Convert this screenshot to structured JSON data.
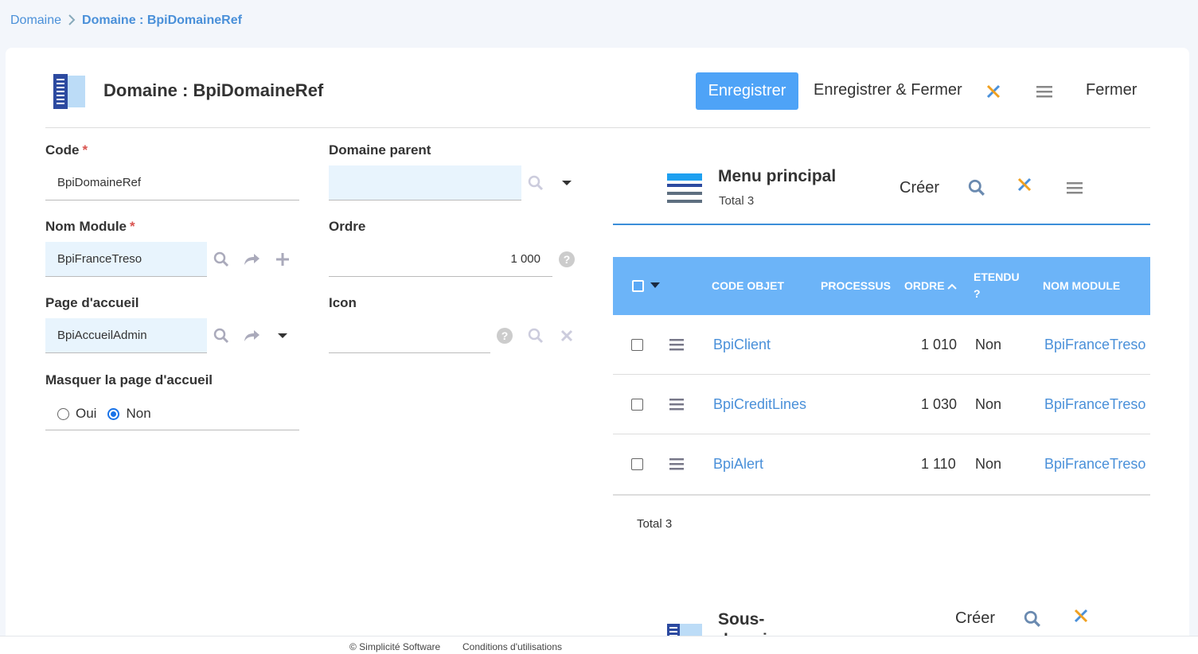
{
  "breadcrumb": {
    "parent": "Domaine",
    "current": "Domaine : BpiDomaineRef"
  },
  "header": {
    "title": "Domaine : BpiDomaineRef",
    "save_label": "Enregistrer",
    "save_close_label": "Enregistrer & Fermer",
    "close_label": "Fermer"
  },
  "form": {
    "code": {
      "label": "Code",
      "required": "*",
      "value": "BpiDomaineRef"
    },
    "nom_module": {
      "label": "Nom Module",
      "required": "*",
      "value": "BpiFranceTreso"
    },
    "page_accueil": {
      "label": "Page d'accueil",
      "value": "BpiAccueilAdmin"
    },
    "masquer": {
      "label": "Masquer la page d'accueil",
      "oui": "Oui",
      "non": "Non",
      "selected": "Non"
    },
    "domaine_parent": {
      "label": "Domaine parent",
      "value": ""
    },
    "ordre": {
      "label": "Ordre",
      "value": "1 000"
    },
    "icon": {
      "label": "Icon",
      "value": ""
    }
  },
  "menu": {
    "title": "Menu principal",
    "total": "Total 3",
    "create_label": "Créer",
    "columns": [
      "CODE OBJET",
      "PROCESSUS",
      "ORDRE",
      "ETENDU ?",
      "NOM MODULE"
    ],
    "rows": [
      {
        "code": "BpiClient",
        "processus": "",
        "ordre": "1 010",
        "etendu": "Non",
        "module": "BpiFranceTreso"
      },
      {
        "code": "BpiCreditLines",
        "processus": "",
        "ordre": "1 030",
        "etendu": "Non",
        "module": "BpiFranceTreso"
      },
      {
        "code": "BpiAlert",
        "processus": "",
        "ordre": "1 110",
        "etendu": "Non",
        "module": "BpiFranceTreso"
      }
    ],
    "footer_total": "Total 3"
  },
  "subdomain": {
    "title": "Sous-domaines",
    "create_label": "Créer"
  },
  "footer": {
    "copyright": "© Simplicité Software",
    "terms": "Conditions d'utilisations"
  },
  "colors": {
    "primary": "#4ea3f7",
    "table_header": "#6cb4f8",
    "link": "#4a90d9",
    "input_bg": "#e8f4fd"
  }
}
